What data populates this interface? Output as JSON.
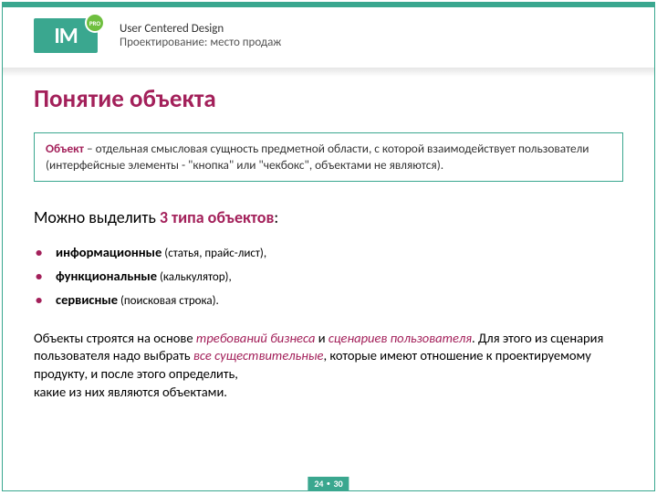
{
  "logo": {
    "text": "IM",
    "badge": "PRO"
  },
  "header": {
    "line1": "User Centered Design",
    "line2": "Проектирование: место продаж"
  },
  "heading": "Понятие объекта",
  "definition": {
    "term": "Объект",
    "rest": " – отдельная смысловая сущность предметной области, с которой взаимодействует пользователи (интерфейсные элементы - \"кнопка\" или  \"чекбокс\", объектами не являются)."
  },
  "section": {
    "prefix": "Можно выделить ",
    "highlight": "3 типа объектов",
    "suffix": ":"
  },
  "types": [
    {
      "name": "информационные",
      "note": " (статья, прайс-лист),"
    },
    {
      "name": "функциональные",
      "note": " (калькулятор),"
    },
    {
      "name": "сервисные",
      "note": " (поисковая строка)."
    }
  ],
  "paragraph": {
    "p1a": "Объекты строятся на основе ",
    "em1": "требований бизнеса",
    "p1b": " и ",
    "em2": "сценариев пользователя",
    "p1c": ". Для этого из сценария пользователя надо выбрать ",
    "em3": "все существительные",
    "p1d": ", которые имеют отношение к проектируемому продукту, и после этого определить,",
    "p1e": "какие из них являются объектами."
  },
  "footer": {
    "page": "24",
    "total": "30"
  }
}
